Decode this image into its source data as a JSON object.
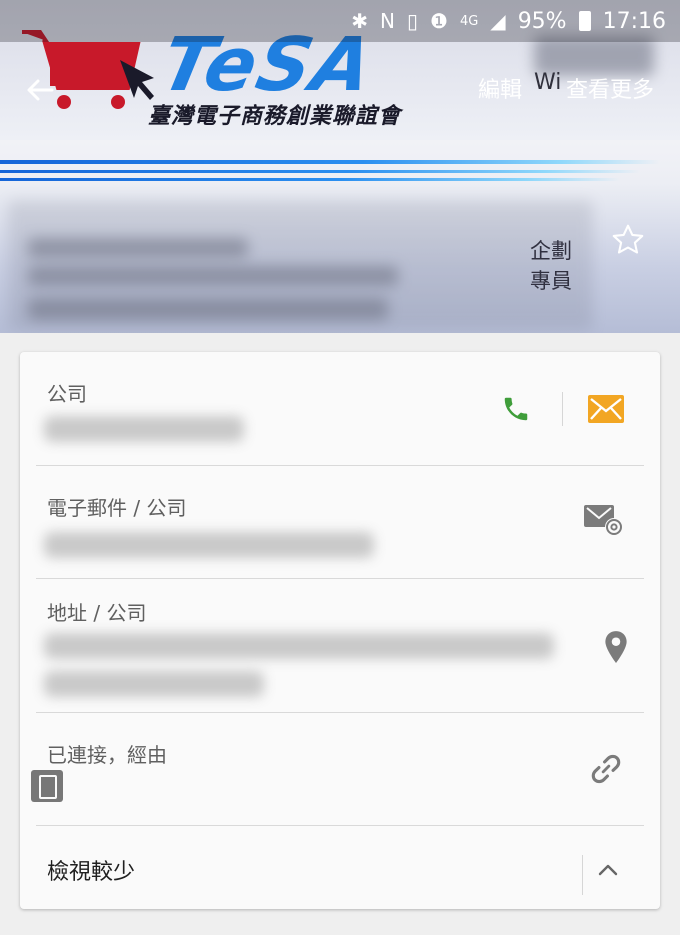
{
  "status_bar": {
    "battery": "95%",
    "time": "17:16",
    "network": "4G",
    "icons": [
      "bluetooth-icon",
      "nfc-icon",
      "vibrate-icon",
      "sim-icon",
      "signal-icon",
      "battery-icon"
    ]
  },
  "header": {
    "logo_wordmark": "TeSA",
    "logo_subtitle": "臺灣電子商務創業聯誼會",
    "edit_label": "編輯",
    "more_label": "查看更多",
    "card_right_top": "Wi",
    "card_right_title": "企劃\n專員",
    "card_right_title_line1": "企劃",
    "card_right_title_line2": "專員"
  },
  "details": {
    "phone_label": "公司",
    "email_label": "電子郵件 / 公司",
    "address_label": "地址 / 公司",
    "connected_label": "已連接，經由",
    "show_less_label": "檢視較少"
  },
  "colors": {
    "phone_green": "#3f9d3a",
    "mail_orange": "#f2a623",
    "icon_gray": "#7b7b7b",
    "brand_blue": "#1f7fe0",
    "brand_red": "#c8192a"
  }
}
